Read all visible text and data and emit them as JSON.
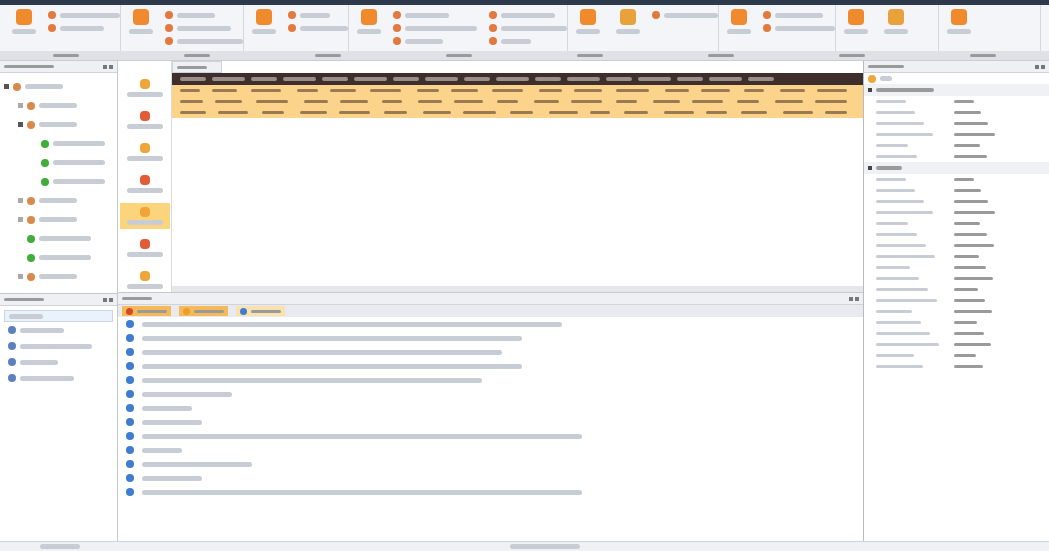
{
  "ribbon": {
    "groups": [
      {
        "items": [
          {
            "kind": "large"
          },
          {
            "kind": "small"
          },
          {
            "kind": "small"
          }
        ]
      },
      {
        "items": [
          {
            "kind": "large"
          },
          {
            "kind": "small"
          },
          {
            "kind": "small"
          },
          {
            "kind": "small"
          }
        ]
      },
      {
        "items": [
          {
            "kind": "large"
          },
          {
            "kind": "small"
          },
          {
            "kind": "small"
          }
        ]
      },
      {
        "items": [
          {
            "kind": "large"
          },
          {
            "kind": "small"
          },
          {
            "kind": "small"
          },
          {
            "kind": "small"
          },
          {
            "kind": "small"
          },
          {
            "kind": "small"
          },
          {
            "kind": "small"
          }
        ]
      },
      {
        "items": [
          {
            "kind": "large"
          },
          {
            "kind": "large"
          },
          {
            "kind": "small"
          }
        ]
      },
      {
        "items": [
          {
            "kind": "large"
          },
          {
            "kind": "small"
          },
          {
            "kind": "small"
          }
        ]
      },
      {
        "items": [
          {
            "kind": "large"
          },
          {
            "kind": "large"
          }
        ]
      },
      {
        "items": [
          {
            "kind": "large"
          }
        ]
      }
    ]
  },
  "tree": {
    "items": [
      {
        "kind": "folder",
        "expanded": true,
        "children": [
          {
            "kind": "folder",
            "expanded": false
          },
          {
            "kind": "folder",
            "expanded": true,
            "children": [
              {
                "kind": "leaf"
              },
              {
                "kind": "leaf"
              },
              {
                "kind": "leaf"
              }
            ]
          },
          {
            "kind": "folder",
            "expanded": false
          },
          {
            "kind": "folder",
            "expanded": false
          },
          {
            "kind": "leaf"
          },
          {
            "kind": "leaf"
          },
          {
            "kind": "folder",
            "expanded": false
          }
        ]
      }
    ]
  },
  "toolbox": {
    "items": [
      {
        "selected": false
      },
      {
        "selected": false
      },
      {
        "selected": false
      },
      {
        "selected": false
      },
      {
        "selected": true
      },
      {
        "selected": false
      },
      {
        "selected": false
      }
    ]
  },
  "grid": {
    "columns": [
      {
        "kind": "text"
      },
      {
        "kind": "text"
      },
      {
        "kind": "text"
      },
      {
        "kind": "text"
      },
      {
        "kind": "text"
      },
      {
        "kind": "text"
      },
      {
        "kind": "text"
      },
      {
        "kind": "text"
      },
      {
        "kind": "text"
      },
      {
        "kind": "text"
      },
      {
        "kind": "text"
      },
      {
        "kind": "text"
      },
      {
        "kind": "text"
      },
      {
        "kind": "text"
      },
      {
        "kind": "text"
      },
      {
        "kind": "text"
      },
      {
        "kind": "text"
      }
    ],
    "rows": [
      {
        "selected": true
      },
      {
        "selected": true
      },
      {
        "selected": true
      }
    ]
  },
  "links": {
    "items": [
      {
        "kind": "link"
      },
      {
        "kind": "link"
      },
      {
        "kind": "link"
      },
      {
        "kind": "link"
      }
    ]
  },
  "messages": {
    "tabs": [
      {
        "kind": "error",
        "selected": true
      },
      {
        "kind": "warning",
        "selected": true
      },
      {
        "kind": "info",
        "selected": false
      }
    ],
    "items": [
      {
        "kind": "info"
      },
      {
        "kind": "info"
      },
      {
        "kind": "info"
      },
      {
        "kind": "info"
      },
      {
        "kind": "info"
      },
      {
        "kind": "info"
      },
      {
        "kind": "info"
      },
      {
        "kind": "info"
      },
      {
        "kind": "info"
      },
      {
        "kind": "info"
      },
      {
        "kind": "info"
      },
      {
        "kind": "info"
      },
      {
        "kind": "info"
      }
    ]
  },
  "properties": {
    "groups": [
      {
        "expanded": true,
        "rows": [
          {
            "kind": "field"
          },
          {
            "kind": "field"
          },
          {
            "kind": "field"
          },
          {
            "kind": "field"
          },
          {
            "kind": "field"
          },
          {
            "kind": "field"
          }
        ]
      },
      {
        "expanded": true,
        "rows": [
          {
            "kind": "field"
          },
          {
            "kind": "field"
          },
          {
            "kind": "field"
          },
          {
            "kind": "field"
          },
          {
            "kind": "field"
          },
          {
            "kind": "field"
          },
          {
            "kind": "field"
          },
          {
            "kind": "field"
          },
          {
            "kind": "field"
          },
          {
            "kind": "field"
          },
          {
            "kind": "field"
          },
          {
            "kind": "field"
          },
          {
            "kind": "field"
          },
          {
            "kind": "field"
          },
          {
            "kind": "field"
          },
          {
            "kind": "field"
          },
          {
            "kind": "field"
          },
          {
            "kind": "field"
          }
        ]
      }
    ]
  }
}
